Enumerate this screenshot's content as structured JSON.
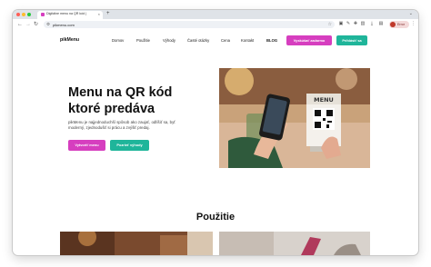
{
  "browser": {
    "tab_title": "Digitálne menu na QR kód |",
    "url": "pikmenu.com",
    "profile_label": "Error"
  },
  "site": {
    "logo": "pikMenu",
    "nav": [
      "Domov",
      "Použitie",
      "Výhody",
      "Časté otázky",
      "Cena",
      "Kontakt",
      "BLOG"
    ],
    "cta_try": "Vyskúšať zadarmo",
    "cta_login": "Prihlásiť sa"
  },
  "hero": {
    "title_line1": "Menu na QR kód",
    "title_line2": "ktoré predáva",
    "description": "pikMenu je najjednoduchší spôsob ako zaujať, odlíšiť sa, byť moderný, zjednodušiť si prácu a zvýšiť predaj.",
    "btn_create": "Vytvoriť menu",
    "btn_benefits": "Pozrieť výhody",
    "image_sign_text": "MENU"
  },
  "section": {
    "title": "Použitie"
  },
  "colors": {
    "magenta": "#d63ebf",
    "teal": "#1fb59a"
  }
}
